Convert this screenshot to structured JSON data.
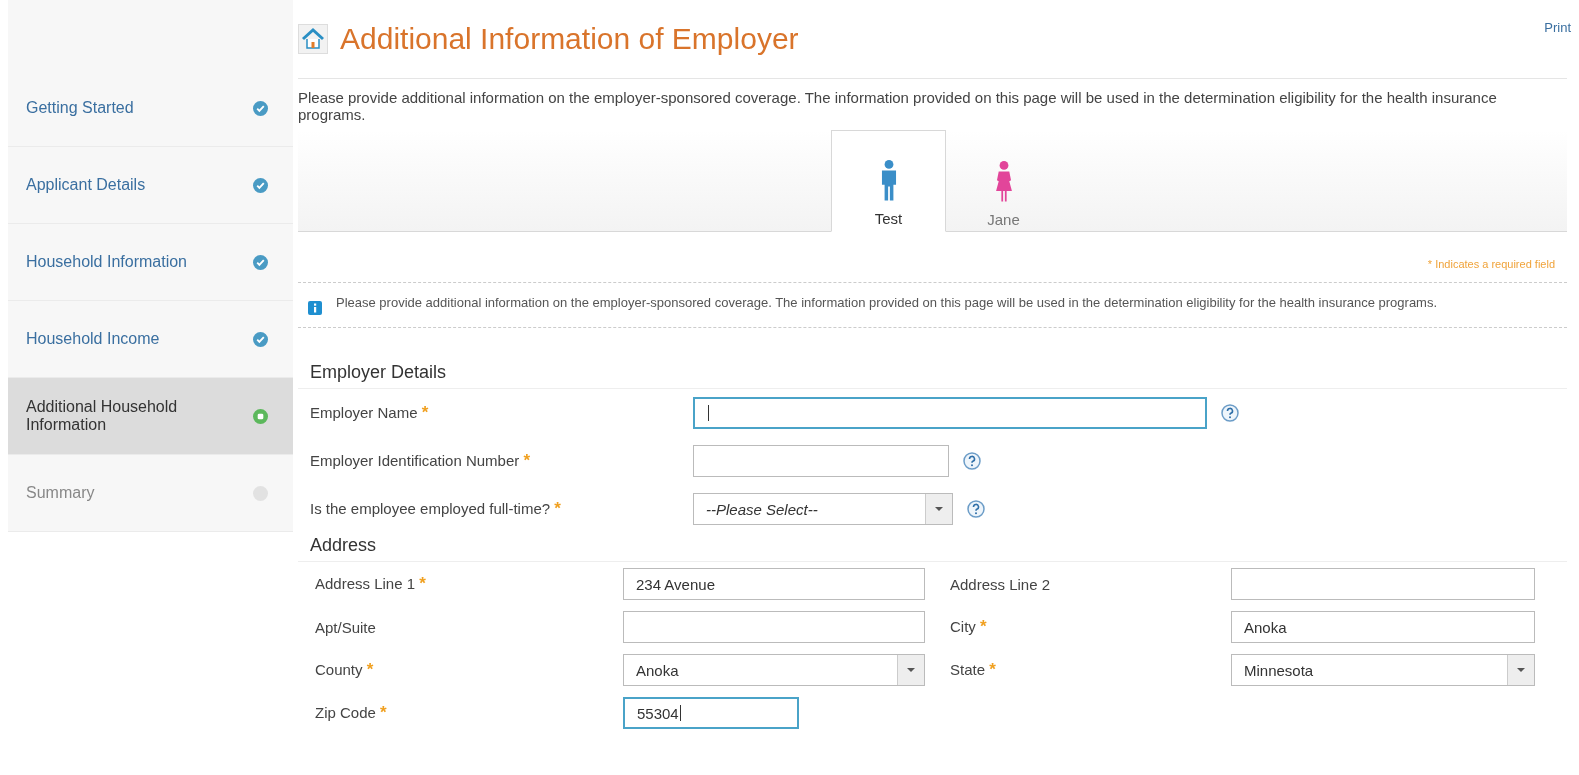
{
  "sidebar": {
    "items": [
      {
        "label": "Getting Started",
        "kind": "done",
        "selected": false
      },
      {
        "label": "Applicant Details",
        "kind": "done",
        "selected": false
      },
      {
        "label": "Household Information",
        "kind": "done",
        "selected": false
      },
      {
        "label": "Household Income",
        "kind": "done",
        "selected": false
      },
      {
        "label": "Additional Household Information",
        "kind": "current",
        "selected": true
      },
      {
        "label": "Summary",
        "kind": "pending",
        "selected": false
      }
    ]
  },
  "header": {
    "title": "Additional Information of Employer",
    "print_link": "Print"
  },
  "intro": "Please provide additional information on the employer-sponsored coverage. The information provided on this page will be used in the determination eligibility for the health insurance programs.",
  "person_tabs": [
    {
      "label": "Test",
      "kind": "man",
      "selected": true
    },
    {
      "label": "Jane",
      "kind": "woman",
      "selected": false
    }
  ],
  "required_note": "* Indicates a required field",
  "info_box": "Please provide additional information on the employer-sponsored coverage. The information provided on this page will be used in the determination eligibility for the health insurance programs.",
  "employer_details": {
    "heading": "Employer Details",
    "fields": [
      {
        "label": "Employer Name",
        "mark": "*",
        "kind": "text",
        "focused": true,
        "help": true
      },
      {
        "label": "Employer Identification Number",
        "mark": "*",
        "kind": "text",
        "focused": false,
        "help": true
      },
      {
        "label": "Is the employee employed full-time?",
        "mark": "*",
        "kind": "select",
        "focused": false,
        "help": true,
        "value": "--Please Select--"
      }
    ]
  },
  "address": {
    "heading": "Address",
    "fields": [
      {
        "label": "Address Line 1",
        "mark": "*",
        "kind": "text",
        "value": "234 Avenue",
        "focused": false
      },
      {
        "label": "Address Line 2",
        "kind": "text",
        "focused": false
      },
      {
        "label": "Apt/Suite",
        "kind": "text",
        "focused": false
      },
      {
        "label": "City",
        "mark": "*",
        "kind": "text",
        "value": "Anoka",
        "focused": false
      },
      {
        "label": "County",
        "mark": "*",
        "kind": "select",
        "value": "Anoka",
        "focused": false
      },
      {
        "label": "State",
        "mark": "*",
        "kind": "select",
        "value": "Minnesota",
        "focused": false
      },
      {
        "label": "Zip Code",
        "mark": "*",
        "kind": "text",
        "value": "55304",
        "focused": true
      }
    ]
  }
}
